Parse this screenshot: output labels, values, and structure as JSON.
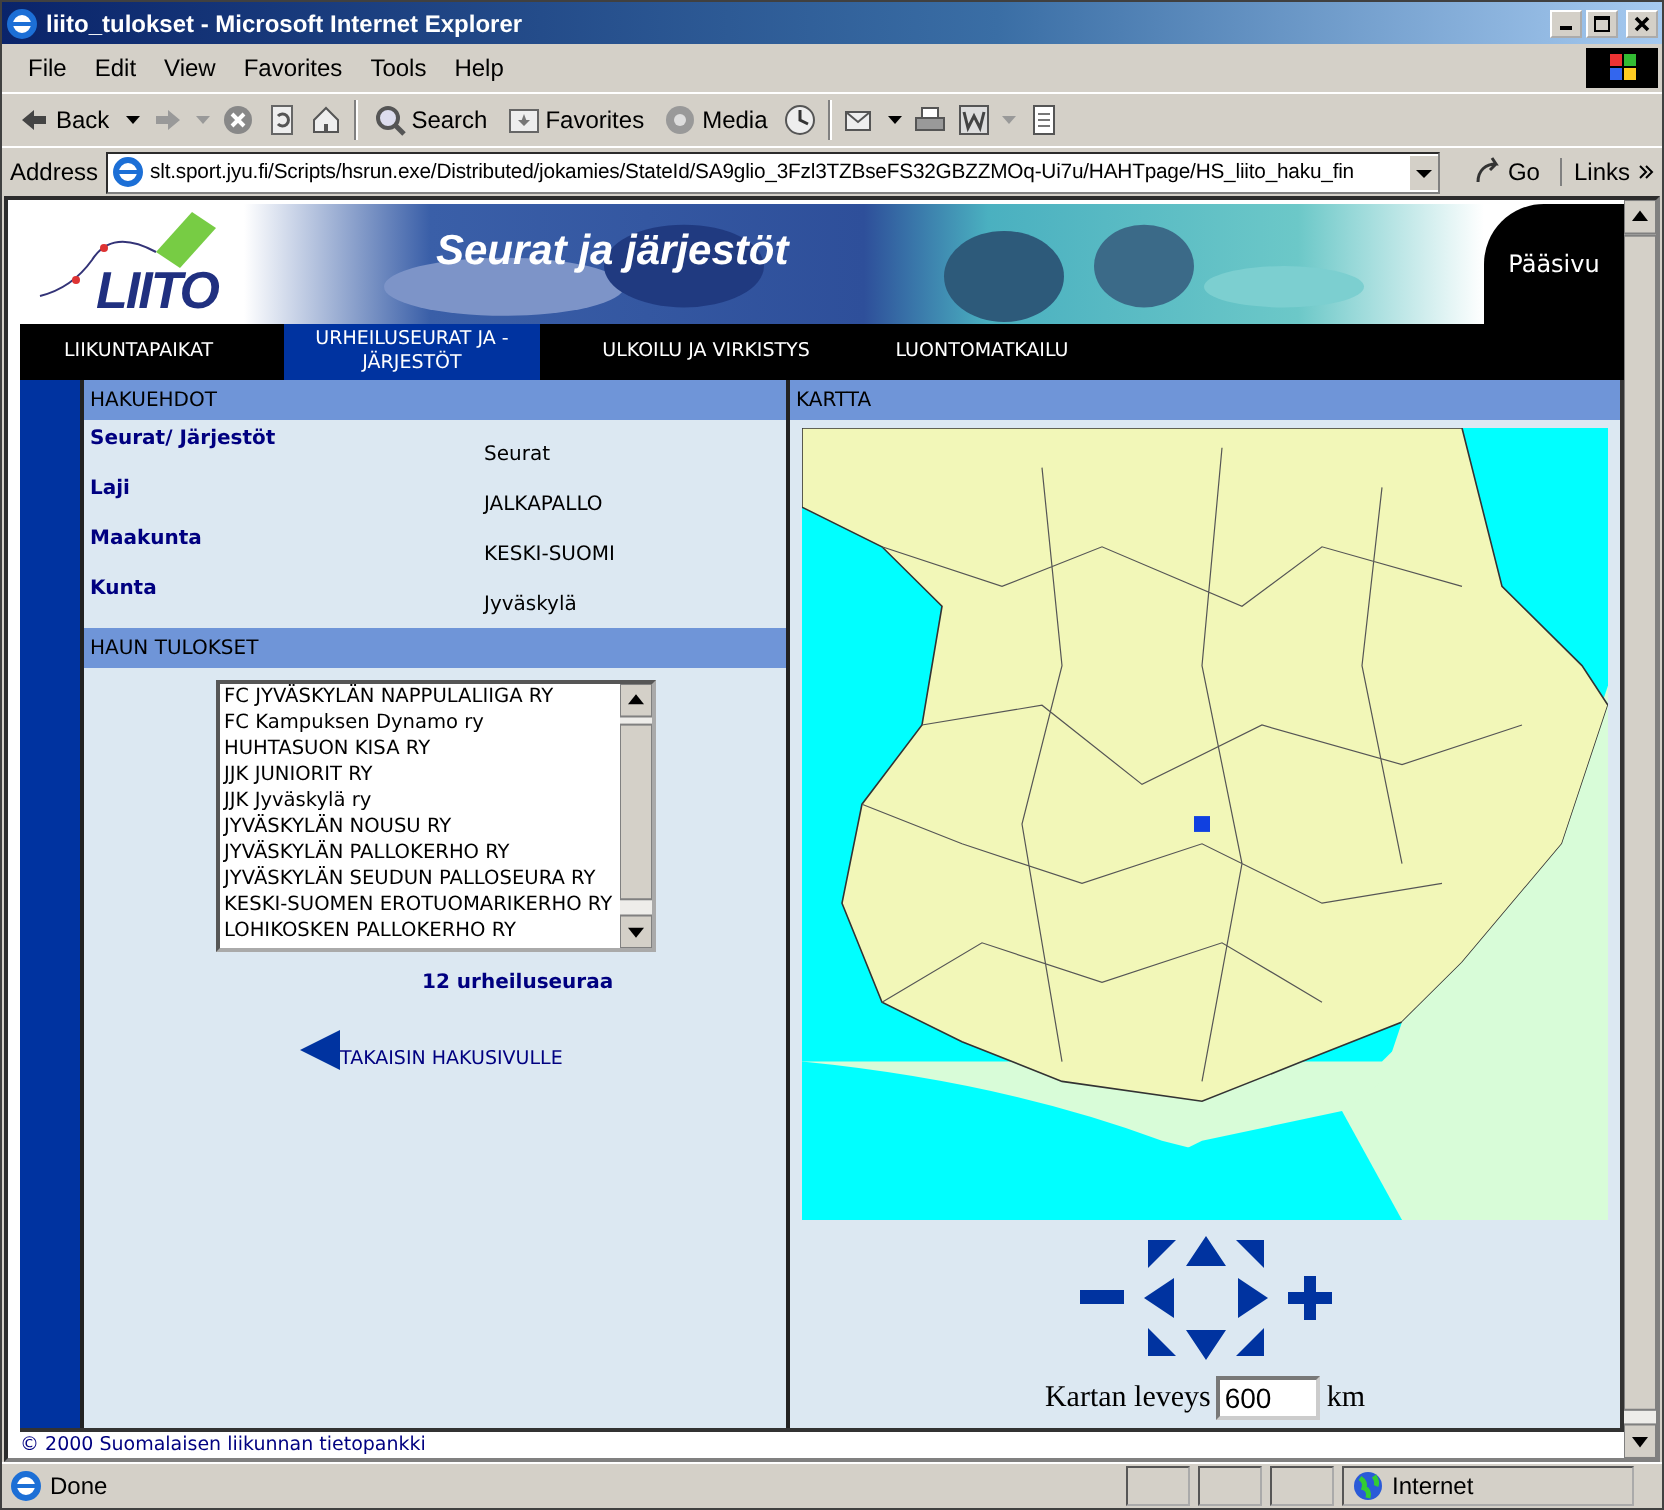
{
  "window": {
    "title": "liito_tulokset - Microsoft Internet Explorer"
  },
  "menu": [
    "File",
    "Edit",
    "View",
    "Favorites",
    "Tools",
    "Help"
  ],
  "toolbar": {
    "back": "Back",
    "search": "Search",
    "favorites": "Favorites",
    "media": "Media"
  },
  "address": {
    "label": "Address",
    "url": "slt.sport.jyu.fi/Scripts/hsrun.exe/Distributed/jokamies/StateId/SA9glio_3Fzl3TZBseFS32GBZZMOq-Ui7u/HAHTpage/HS_liito_haku_fin",
    "go": "Go",
    "links": "Links"
  },
  "banner": {
    "logo": "LIITO",
    "heading": "Seurat ja järjestöt",
    "home_link": "Pääsivu"
  },
  "nav": [
    {
      "label": "LIIKUNTAPAIKAT",
      "selected": false
    },
    {
      "label": "URHEILUSEURAT JA - JÄRJESTÖT",
      "selected": true
    },
    {
      "label": "ULKOILU JA VIRKISTYS",
      "selected": false
    },
    {
      "label": "LUONTOMATKAILU",
      "selected": false
    }
  ],
  "criteria": {
    "heading": "HAKUEHDOT",
    "rows": [
      {
        "label": "Seurat/ Järjestöt",
        "value": "Seurat"
      },
      {
        "label": "Laji",
        "value": "JALKAPALLO"
      },
      {
        "label": "Maakunta",
        "value": "KESKI-SUOMI"
      },
      {
        "label": "Kunta",
        "value": "Jyväskylä"
      }
    ]
  },
  "results": {
    "heading": "HAUN TULOKSET",
    "items": [
      "FC JYVÄSKYLÄN NAPPULALIIGA RY",
      "FC Kampuksen Dynamo ry",
      "HUHTASUON KISA RY",
      "JJK JUNIORIT RY",
      "JJK Jyväskylä ry",
      "JYVÄSKYLÄN NOUSU RY",
      "JYVÄSKYLÄN PALLOKERHO RY",
      "JYVÄSKYLÄN SEUDUN PALLOSEURA RY",
      "KESKI-SUOMEN EROTUOMARIKERHO RY",
      "LOHIKOSKEN PALLOKERHO RY"
    ],
    "count": "12 urheiluseuraa",
    "back_link": "TAKAISIN HAKUSIVULLE"
  },
  "map": {
    "heading": "KARTTA",
    "width_label": "Kartan leveys",
    "width_value": "600",
    "unit": "km"
  },
  "footer": "© 2000 Suomalaisen liikunnan tietopankki",
  "status": {
    "text": "Done",
    "zone": "Internet"
  }
}
